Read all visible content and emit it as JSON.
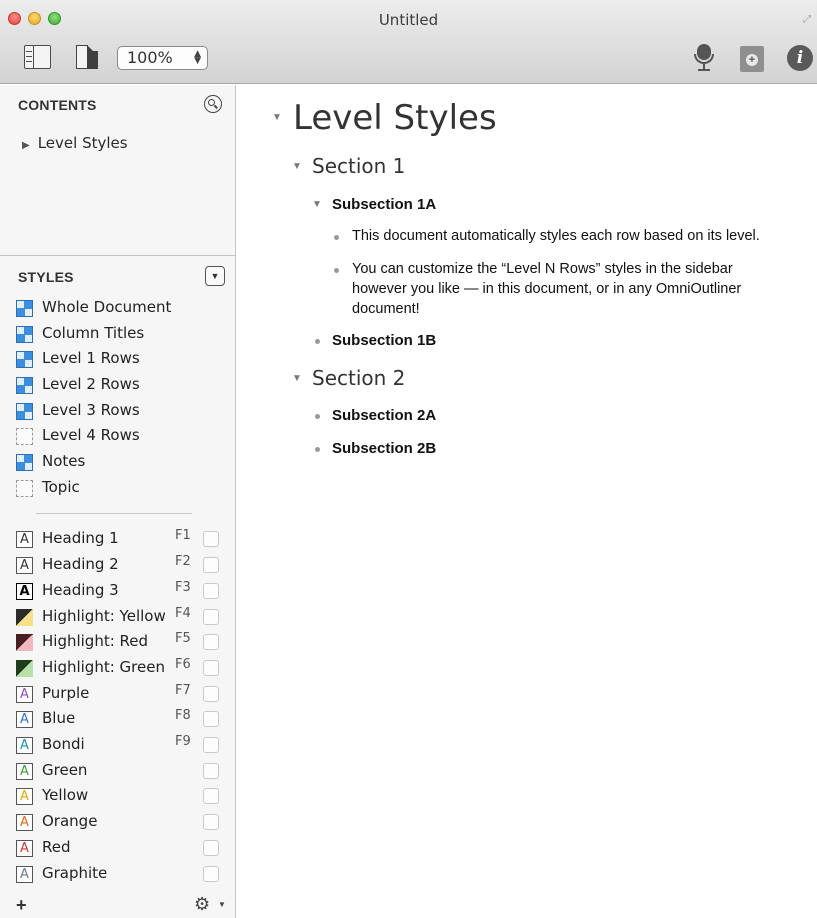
{
  "window": {
    "title": "Untitled"
  },
  "toolbar": {
    "zoom": "100%"
  },
  "sidebar": {
    "contents_header": "CONTENTS",
    "contents_items": [
      {
        "label": "Level Styles"
      }
    ],
    "styles_header": "STYLES",
    "document_styles": [
      {
        "label": "Whole Document",
        "swatch": "blue"
      },
      {
        "label": "Column Titles",
        "swatch": "blue"
      },
      {
        "label": "Level 1 Rows",
        "swatch": "blue"
      },
      {
        "label": "Level 2 Rows",
        "swatch": "blue"
      },
      {
        "label": "Level 3 Rows",
        "swatch": "blue"
      },
      {
        "label": "Level 4 Rows",
        "swatch": "dashed"
      },
      {
        "label": "Notes",
        "swatch": "blue"
      },
      {
        "label": "Topic",
        "swatch": "dashed"
      }
    ],
    "named_styles": [
      {
        "label": "Heading 1",
        "key": "F1",
        "kind": "A",
        "color": "#333333"
      },
      {
        "label": "Heading 2",
        "key": "F2",
        "kind": "A",
        "color": "#333333"
      },
      {
        "label": "Heading 3",
        "key": "F3",
        "kind": "A-bold",
        "color": "#000000"
      },
      {
        "label": "Highlight: Yellow",
        "key": "F4",
        "kind": "highlight",
        "color": "#f7e08a"
      },
      {
        "label": "Highlight: Red",
        "key": "F5",
        "kind": "highlight",
        "color": "#f2b8c0"
      },
      {
        "label": "Highlight: Green",
        "key": "F6",
        "kind": "highlight",
        "color": "#b9e0a8"
      },
      {
        "label": "Purple",
        "key": "F7",
        "kind": "A",
        "color": "#8e4fc7"
      },
      {
        "label": "Blue",
        "key": "F8",
        "kind": "A",
        "color": "#2f6fd0"
      },
      {
        "label": "Bondi",
        "key": "F9",
        "kind": "A",
        "color": "#1d93a8"
      },
      {
        "label": "Green",
        "key": "",
        "kind": "A",
        "color": "#3c9b3c"
      },
      {
        "label": "Yellow",
        "key": "",
        "kind": "A",
        "color": "#e3a900"
      },
      {
        "label": "Orange",
        "key": "",
        "kind": "A",
        "color": "#e56a1d"
      },
      {
        "label": "Red",
        "key": "",
        "kind": "A",
        "color": "#d63434"
      },
      {
        "label": "Graphite",
        "key": "",
        "kind": "A",
        "color": "#6c7a89"
      }
    ]
  },
  "outline": {
    "title": "Level Styles",
    "sections": [
      {
        "label": "Section 1",
        "subsections": [
          {
            "label": "Subsection 1A",
            "items": [
              {
                "lines": [
                  "This document automatically styles each row based on its level."
                ]
              },
              {
                "lines": [
                  "You can customize the “Level N Rows” styles in the sidebar",
                  "however you like — in this document, or in any OmniOutliner",
                  "document!"
                ]
              }
            ]
          },
          {
            "label": "Subsection 1B",
            "items": []
          }
        ]
      },
      {
        "label": "Section 2",
        "subsections": [
          {
            "label": "Subsection 2A",
            "items": []
          },
          {
            "label": "Subsection 2B",
            "items": []
          }
        ]
      }
    ]
  }
}
